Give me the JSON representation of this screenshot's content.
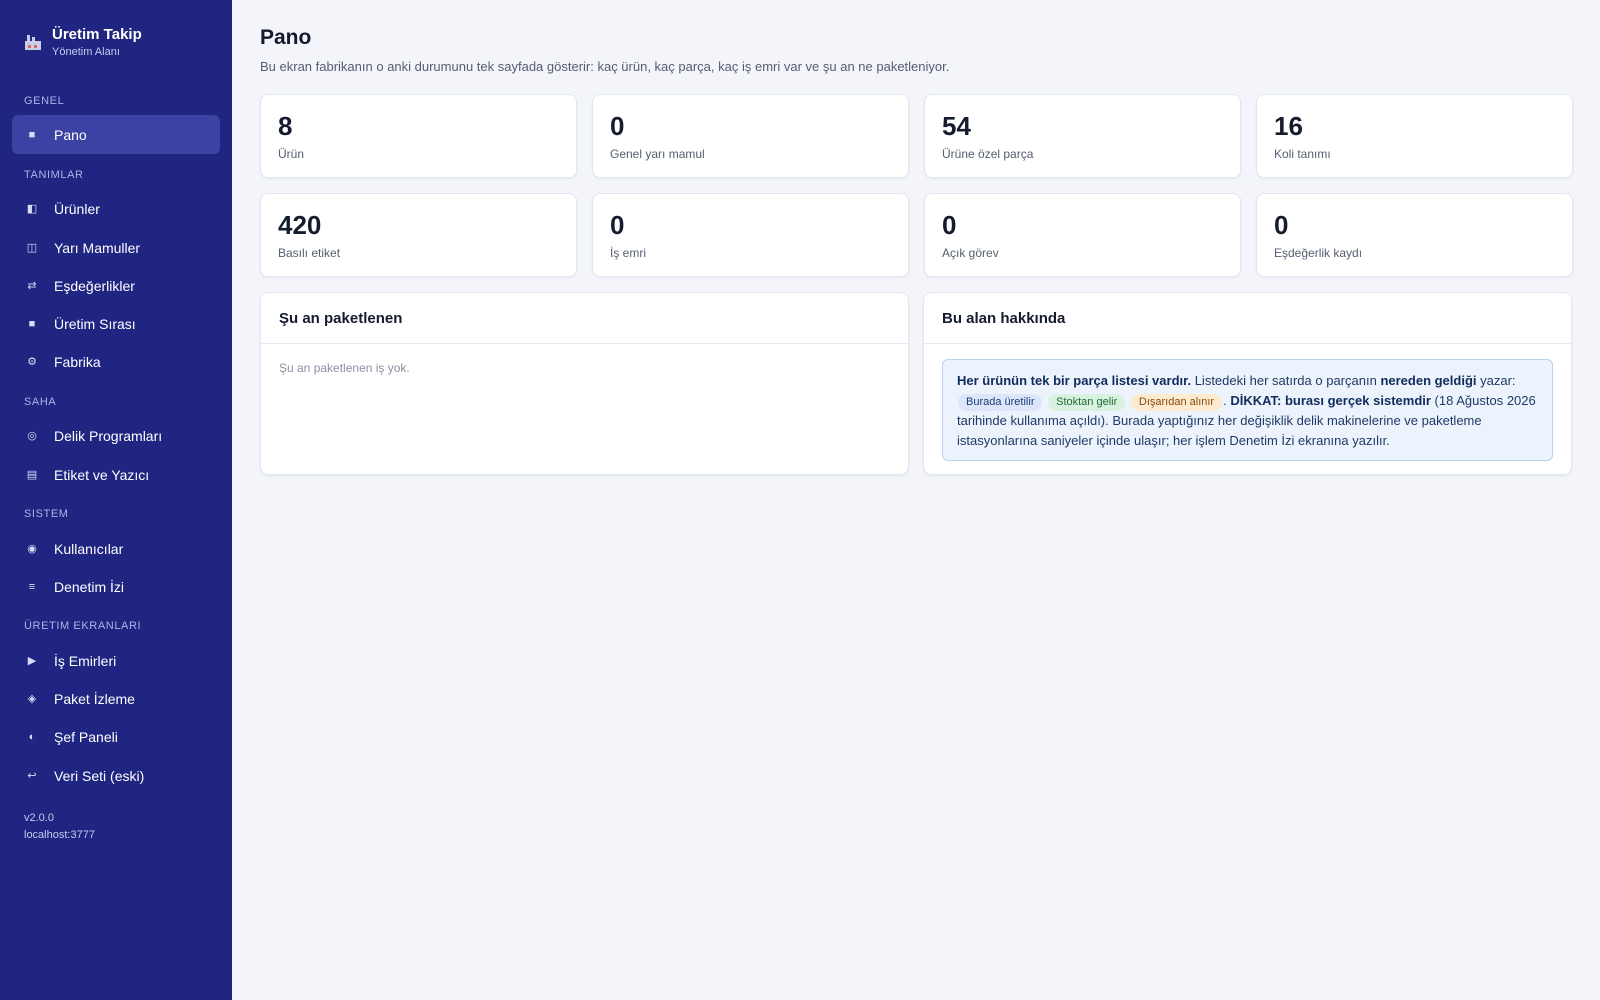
{
  "brand": {
    "title": "Üretim Takip",
    "subtitle": "Yönetim Alanı",
    "icon": "factory-icon"
  },
  "nav": {
    "sections": [
      "Genel",
      "Tanımlar",
      "Saha",
      "Sistem",
      "Üretim Ekranları"
    ],
    "items": [
      {
        "label": "Pano",
        "icon": "■",
        "active": true
      },
      {
        "label": "Ürünler",
        "icon": "◧"
      },
      {
        "label": "Yarı Mamuller",
        "icon": "◫"
      },
      {
        "label": "Eşdeğerlikler",
        "icon": "⇄"
      },
      {
        "label": "Üretim Sırası",
        "icon": "■"
      },
      {
        "label": "Fabrika",
        "icon": "⚙"
      },
      {
        "label": "Delik Programları",
        "icon": "◎"
      },
      {
        "label": "Etiket ve Yazıcı",
        "icon": "▤"
      },
      {
        "label": "Kullanıcılar",
        "icon": "◉"
      },
      {
        "label": "Denetim İzi",
        "icon": "≡"
      },
      {
        "label": "İş Emirleri",
        "icon": "▶"
      },
      {
        "label": "Paket İzleme",
        "icon": "◈"
      },
      {
        "label": "Şef Paneli",
        "icon": "◐"
      },
      {
        "label": "Veri Seti (eski)",
        "icon": "↩"
      }
    ],
    "version": "v2.0.0",
    "host": "localhost:3777"
  },
  "page": {
    "title": "Pano",
    "description": "Bu ekran fabrikanın o anki durumunu tek sayfada gösterir: kaç ürün, kaç parça, kaç iş emri var ve şu an ne paketleniyor."
  },
  "stats": [
    {
      "value": "8",
      "label": "Ürün"
    },
    {
      "value": "0",
      "label": "Genel yarı mamul"
    },
    {
      "value": "54",
      "label": "Ürüne özel parça"
    },
    {
      "value": "16",
      "label": "Koli tanımı"
    },
    {
      "value": "420",
      "label": "Basılı etiket"
    },
    {
      "value": "0",
      "label": "İş emri"
    },
    {
      "value": "0",
      "label": "Açık görev"
    },
    {
      "value": "0",
      "label": "Eşdeğerlik kaydı"
    }
  ],
  "packing": {
    "title": "Şu an paketlenen",
    "empty": "Şu an paketlenen iş yok."
  },
  "about": {
    "title": "Bu alan hakkında",
    "lead": "Her ürünün tek bir parça listesi vardır.",
    "text1": " Listedeki her satırda o parçanın ",
    "strong1": "nereden geldiği",
    "text2": " yazar: ",
    "badge1": "Burada üretilir",
    "badge2": "Stoktan gelir",
    "badge3": "Dışarıdan alınır",
    "text3": ". ",
    "warning": "DİKKAT: burası gerçek sistemdir",
    "text4": " (18 Ağustos 2026 tarihinde kullanıma açıldı). Burada yaptığınız her değişiklik delik makinelerine ve paketleme istasyonlarına saniyeler içinde ulaşır; her işlem Denetim İzi ekranına yazılır."
  }
}
